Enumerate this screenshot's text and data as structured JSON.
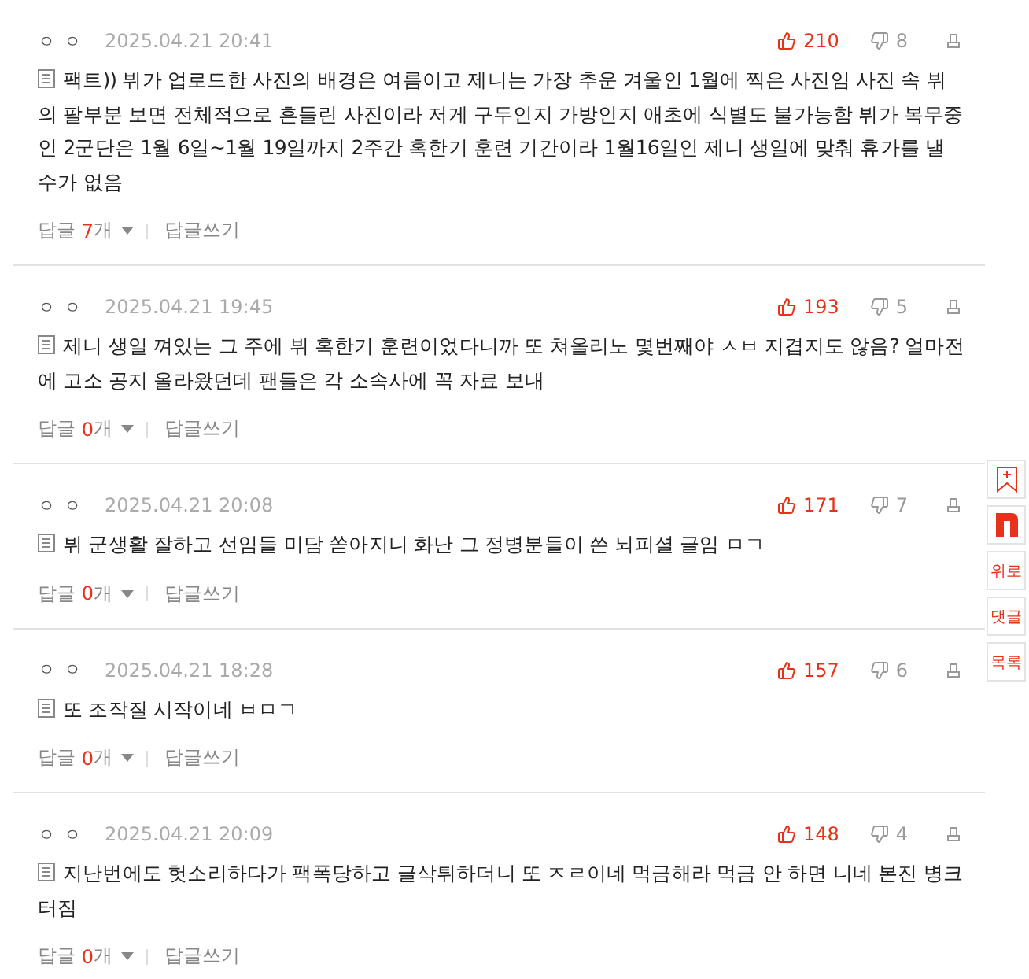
{
  "comments": [
    {
      "author": "ㅇ ㅇ",
      "date": "2025.04.21 20:41",
      "likes": "210",
      "dislikes": "8",
      "text": "팩트)) 뷔가 업로드한 사진의 배경은 여름이고 제니는 가장 추운 겨울인 1월에 찍은 사진임 사진 속 뷔의 팔부분 보면 전체적으로 흔들린 사진이라 저게 구두인지 가방인지 애초에 식별도 불가능함 뷔가 복무중인 2군단은 1월 6일~1월 19일까지 2주간 혹한기 훈련 기간이라 1월16일인 제니 생일에 맞춰 휴가를 낼 수가 없음",
      "reply_label": "답글",
      "reply_count": "7",
      "reply_unit": "개",
      "write_reply": "답글쓰기"
    },
    {
      "author": "ㅇ ㅇ",
      "date": "2025.04.21 19:45",
      "likes": "193",
      "dislikes": "5",
      "text": "제니 생일 껴있는 그 주에 뷔 혹한기 훈련이었다니까 또 쳐올리노 몇번째야 ㅅㅂ 지겹지도 않음? 얼마전에 고소 공지 올라왔던데 팬들은 각 소속사에 꼭 자료 보내",
      "reply_label": "답글",
      "reply_count": "0",
      "reply_unit": "개",
      "write_reply": "답글쓰기"
    },
    {
      "author": "ㅇ ㅇ",
      "date": "2025.04.21 20:08",
      "likes": "171",
      "dislikes": "7",
      "text": "뷔 군생활 잘하고 선임들 미담 쏟아지니 화난 그 정병분들이 쓴 뇌피셜 글임 ㅁㄱ",
      "reply_label": "답글",
      "reply_count": "0",
      "reply_unit": "개",
      "write_reply": "답글쓰기"
    },
    {
      "author": "ㅇ ㅇ",
      "date": "2025.04.21 18:28",
      "likes": "157",
      "dislikes": "6",
      "text": "또 조작질 시작이네 ㅂㅁㄱ",
      "reply_label": "답글",
      "reply_count": "0",
      "reply_unit": "개",
      "write_reply": "답글쓰기"
    },
    {
      "author": "ㅇ ㅇ",
      "date": "2025.04.21 20:09",
      "likes": "148",
      "dislikes": "4",
      "text": "지난번에도 헛소리하다가 팩폭당하고 글삭튀하더니 또 ㅈㄹ이네 먹금해라 먹금 안 하면 니네 본진 병크터짐",
      "reply_label": "답글",
      "reply_count": "0",
      "reply_unit": "개",
      "write_reply": "답글쓰기"
    }
  ],
  "side_buttons": [
    {
      "kind": "bookmark"
    },
    {
      "kind": "logo"
    },
    {
      "kind": "text",
      "label": "위로"
    },
    {
      "kind": "text",
      "label": "댓글"
    },
    {
      "kind": "text",
      "label": "목록"
    }
  ]
}
